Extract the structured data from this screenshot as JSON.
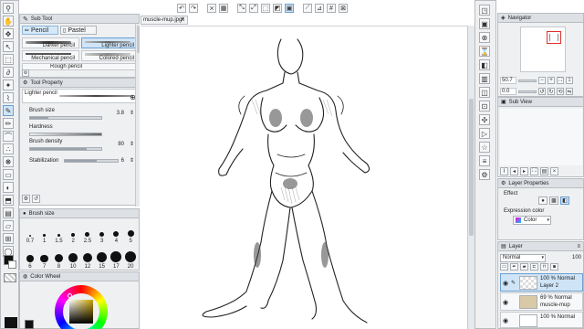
{
  "document_tab": {
    "label": "muscle-mup.jpg*"
  },
  "sub_tool": {
    "title": "Sub Tool",
    "tabs": [
      "Pencil",
      "Pastel"
    ],
    "items": [
      {
        "label": "Darker pencil"
      },
      {
        "label": "Lighter pencil",
        "selected": true
      },
      {
        "label": "Mechanical pencil"
      },
      {
        "label": "Colored pencil"
      },
      {
        "label": "Rough pencil"
      }
    ]
  },
  "tool_property": {
    "title": "Tool Property",
    "current_tool": "Lighter pencil",
    "brush_size": {
      "label": "Brush size",
      "value": "3.8",
      "fraction": 0.25
    },
    "hardness": {
      "label": "Hardness"
    },
    "brush_density": {
      "label": "Brush density",
      "value": "80",
      "fraction": 0.8
    },
    "stabilization": {
      "label": "Stabilization",
      "value": "6",
      "fraction": 0.6
    }
  },
  "brush_size_panel": {
    "title": "Brush size",
    "sizes": [
      "0.7",
      "1",
      "1.5",
      "2",
      "2.5",
      "3",
      "4",
      "5",
      "6",
      "7",
      "8",
      "10",
      "12",
      "15",
      "17",
      "20"
    ]
  },
  "color_wheel": {
    "title": "Color Wheel"
  },
  "navigator": {
    "title": "Navigator",
    "zoom": "50.7",
    "rotation": "0.0"
  },
  "sub_view": {
    "title": "Sub View"
  },
  "layer_properties": {
    "title": "Layer Properties",
    "effect_label": "Effect",
    "expression_color_label": "Expression color",
    "expression_color_value": "Color"
  },
  "layer_panel": {
    "title": "Layer",
    "blend_mode": "Normal",
    "opacity": "100",
    "layers": [
      {
        "opacity": "100 %",
        "mode": "Normal",
        "name": "Layer 2"
      },
      {
        "opacity": "69 %",
        "mode": "Normal",
        "name": "muscle-mup"
      },
      {
        "opacity": "100 %",
        "mode": "Normal",
        "name": ""
      }
    ]
  },
  "colors": {
    "panel_bg": "#eef0f2",
    "header_bg": "#dde1e6",
    "accent": "#cfe4f7",
    "layer_swatch": "#d9c9a6"
  }
}
